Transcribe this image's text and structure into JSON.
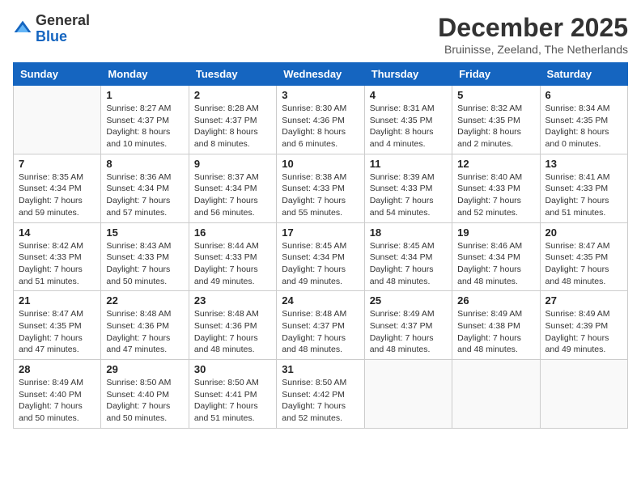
{
  "header": {
    "logo_line1": "General",
    "logo_line2": "Blue",
    "month_title": "December 2025",
    "subtitle": "Bruinisse, Zeeland, The Netherlands"
  },
  "days_of_week": [
    "Sunday",
    "Monday",
    "Tuesday",
    "Wednesday",
    "Thursday",
    "Friday",
    "Saturday"
  ],
  "weeks": [
    [
      {
        "day": "",
        "text": ""
      },
      {
        "day": "1",
        "text": "Sunrise: 8:27 AM\nSunset: 4:37 PM\nDaylight: 8 hours\nand 10 minutes."
      },
      {
        "day": "2",
        "text": "Sunrise: 8:28 AM\nSunset: 4:37 PM\nDaylight: 8 hours\nand 8 minutes."
      },
      {
        "day": "3",
        "text": "Sunrise: 8:30 AM\nSunset: 4:36 PM\nDaylight: 8 hours\nand 6 minutes."
      },
      {
        "day": "4",
        "text": "Sunrise: 8:31 AM\nSunset: 4:35 PM\nDaylight: 8 hours\nand 4 minutes."
      },
      {
        "day": "5",
        "text": "Sunrise: 8:32 AM\nSunset: 4:35 PM\nDaylight: 8 hours\nand 2 minutes."
      },
      {
        "day": "6",
        "text": "Sunrise: 8:34 AM\nSunset: 4:35 PM\nDaylight: 8 hours\nand 0 minutes."
      }
    ],
    [
      {
        "day": "7",
        "text": "Sunrise: 8:35 AM\nSunset: 4:34 PM\nDaylight: 7 hours\nand 59 minutes."
      },
      {
        "day": "8",
        "text": "Sunrise: 8:36 AM\nSunset: 4:34 PM\nDaylight: 7 hours\nand 57 minutes."
      },
      {
        "day": "9",
        "text": "Sunrise: 8:37 AM\nSunset: 4:34 PM\nDaylight: 7 hours\nand 56 minutes."
      },
      {
        "day": "10",
        "text": "Sunrise: 8:38 AM\nSunset: 4:33 PM\nDaylight: 7 hours\nand 55 minutes."
      },
      {
        "day": "11",
        "text": "Sunrise: 8:39 AM\nSunset: 4:33 PM\nDaylight: 7 hours\nand 54 minutes."
      },
      {
        "day": "12",
        "text": "Sunrise: 8:40 AM\nSunset: 4:33 PM\nDaylight: 7 hours\nand 52 minutes."
      },
      {
        "day": "13",
        "text": "Sunrise: 8:41 AM\nSunset: 4:33 PM\nDaylight: 7 hours\nand 51 minutes."
      }
    ],
    [
      {
        "day": "14",
        "text": "Sunrise: 8:42 AM\nSunset: 4:33 PM\nDaylight: 7 hours\nand 51 minutes."
      },
      {
        "day": "15",
        "text": "Sunrise: 8:43 AM\nSunset: 4:33 PM\nDaylight: 7 hours\nand 50 minutes."
      },
      {
        "day": "16",
        "text": "Sunrise: 8:44 AM\nSunset: 4:33 PM\nDaylight: 7 hours\nand 49 minutes."
      },
      {
        "day": "17",
        "text": "Sunrise: 8:45 AM\nSunset: 4:34 PM\nDaylight: 7 hours\nand 49 minutes."
      },
      {
        "day": "18",
        "text": "Sunrise: 8:45 AM\nSunset: 4:34 PM\nDaylight: 7 hours\nand 48 minutes."
      },
      {
        "day": "19",
        "text": "Sunrise: 8:46 AM\nSunset: 4:34 PM\nDaylight: 7 hours\nand 48 minutes."
      },
      {
        "day": "20",
        "text": "Sunrise: 8:47 AM\nSunset: 4:35 PM\nDaylight: 7 hours\nand 48 minutes."
      }
    ],
    [
      {
        "day": "21",
        "text": "Sunrise: 8:47 AM\nSunset: 4:35 PM\nDaylight: 7 hours\nand 47 minutes."
      },
      {
        "day": "22",
        "text": "Sunrise: 8:48 AM\nSunset: 4:36 PM\nDaylight: 7 hours\nand 47 minutes."
      },
      {
        "day": "23",
        "text": "Sunrise: 8:48 AM\nSunset: 4:36 PM\nDaylight: 7 hours\nand 48 minutes."
      },
      {
        "day": "24",
        "text": "Sunrise: 8:48 AM\nSunset: 4:37 PM\nDaylight: 7 hours\nand 48 minutes."
      },
      {
        "day": "25",
        "text": "Sunrise: 8:49 AM\nSunset: 4:37 PM\nDaylight: 7 hours\nand 48 minutes."
      },
      {
        "day": "26",
        "text": "Sunrise: 8:49 AM\nSunset: 4:38 PM\nDaylight: 7 hours\nand 48 minutes."
      },
      {
        "day": "27",
        "text": "Sunrise: 8:49 AM\nSunset: 4:39 PM\nDaylight: 7 hours\nand 49 minutes."
      }
    ],
    [
      {
        "day": "28",
        "text": "Sunrise: 8:49 AM\nSunset: 4:40 PM\nDaylight: 7 hours\nand 50 minutes."
      },
      {
        "day": "29",
        "text": "Sunrise: 8:50 AM\nSunset: 4:40 PM\nDaylight: 7 hours\nand 50 minutes."
      },
      {
        "day": "30",
        "text": "Sunrise: 8:50 AM\nSunset: 4:41 PM\nDaylight: 7 hours\nand 51 minutes."
      },
      {
        "day": "31",
        "text": "Sunrise: 8:50 AM\nSunset: 4:42 PM\nDaylight: 7 hours\nand 52 minutes."
      },
      {
        "day": "",
        "text": ""
      },
      {
        "day": "",
        "text": ""
      },
      {
        "day": "",
        "text": ""
      }
    ]
  ]
}
